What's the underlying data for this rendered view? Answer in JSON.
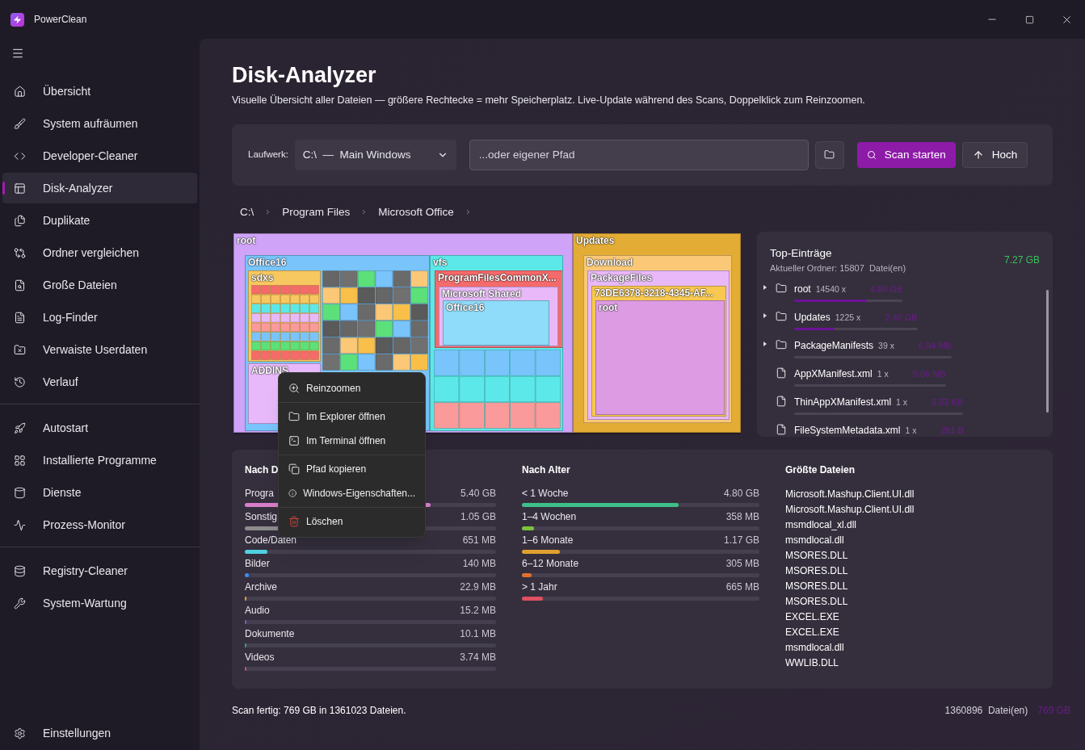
{
  "window": {
    "title": "PowerClean"
  },
  "sidebar": {
    "groups": [
      [
        {
          "label": "Übersicht",
          "selected": false
        },
        {
          "label": "System aufräumen",
          "selected": false
        },
        {
          "label": "Developer-Cleaner",
          "selected": false
        },
        {
          "label": "Disk-Analyzer",
          "selected": true
        },
        {
          "label": "Duplikate",
          "selected": false
        },
        {
          "label": "Ordner vergleichen",
          "selected": false
        },
        {
          "label": "Große Dateien",
          "selected": false
        },
        {
          "label": "Log-Finder",
          "selected": false
        },
        {
          "label": "Verwaiste Userdaten",
          "selected": false
        },
        {
          "label": "Verlauf",
          "selected": false
        }
      ],
      [
        {
          "label": "Autostart",
          "selected": false
        },
        {
          "label": "Installierte Programme",
          "selected": false
        },
        {
          "label": "Dienste",
          "selected": false
        },
        {
          "label": "Prozess-Monitor",
          "selected": false
        }
      ],
      [
        {
          "label": "Registry-Cleaner",
          "selected": false
        },
        {
          "label": "System-Wartung",
          "selected": false
        }
      ]
    ],
    "footer_item": {
      "label": "Einstellungen",
      "selected": false
    }
  },
  "page": {
    "title": "Disk-Analyzer",
    "subtitle": "Visuelle Übersicht aller Dateien — größere Rechtecke = mehr Speicherplatz. Live-Update während des Scans, Doppelklick zum Reinzoomen."
  },
  "toolbar": {
    "drive_label": "Laufwerk:",
    "drive_value": "C:\\  —  Main Windows",
    "path_placeholder": "...oder eigener Pfad",
    "scan_button": "Scan starten",
    "up_button": "Hoch"
  },
  "breadcrumb": [
    "C:\\",
    "Program Files",
    "Microsoft Office"
  ],
  "treemap": {
    "nodes": [
      {
        "label": "root",
        "children": [
          {
            "label": "Office16",
            "children": [
              {
                "label": "sdxs"
              },
              {
                "label": "ADDINS"
              }
            ]
          },
          {
            "label": "vfs",
            "children": [
              {
                "label": "ProgramFilesCommonX...",
                "children": [
                  {
                    "label": "Microsoft Shared",
                    "children": [
                      {
                        "label": "Office16"
                      }
                    ]
                  }
                ]
              }
            ]
          }
        ]
      },
      {
        "label": "Updates",
        "children": [
          {
            "label": "Download",
            "children": [
              {
                "label": "PackageFiles",
                "children": [
                  {
                    "label": "73DE6378-3218-4345-AF...",
                    "children": [
                      {
                        "label": "root"
                      }
                    ]
                  }
                ]
              }
            ]
          }
        ]
      }
    ]
  },
  "context_menu": {
    "groups": [
      [
        {
          "label": "Reinzoomen",
          "kind": "zoom"
        }
      ],
      [
        {
          "label": "Im Explorer öffnen",
          "kind": "folder"
        },
        {
          "label": "Im Terminal öffnen",
          "kind": "terminal"
        }
      ],
      [
        {
          "label": "Pfad kopieren",
          "kind": "copy"
        },
        {
          "label": "Windows-Eigenschaften...",
          "kind": "info"
        }
      ],
      [
        {
          "label": "Löschen",
          "kind": "delete"
        }
      ]
    ]
  },
  "top_entries": {
    "title": "Top-Einträge",
    "subtitle": "Aktueller Ordner: 15807  Datei(en)",
    "total": "7.27 GB",
    "items": [
      {
        "kind": "folder",
        "expanded": false,
        "name": "root",
        "count": "14540 x",
        "size": "4.86 GB",
        "level": 0.67
      },
      {
        "kind": "folder",
        "expanded": false,
        "name": "Updates",
        "count": "1225 x",
        "size": "2.40 GB",
        "level": 0.33
      },
      {
        "kind": "folder",
        "expanded": false,
        "name": "PackageManifests",
        "count": "39 x",
        "size": "6.94 MB"
      },
      {
        "kind": "file",
        "name": "AppXManifest.xml",
        "count": "1 x",
        "size": "5.06 MB"
      },
      {
        "kind": "file",
        "name": "ThinAppXManifest.xml",
        "count": "1 x",
        "size": "3.53 KB"
      },
      {
        "kind": "file",
        "name": "FileSystemMetadata.xml",
        "count": "1 x",
        "size": "281 B"
      }
    ]
  },
  "by_type": {
    "title": "Nach D",
    "items": [
      {
        "label": "Progra",
        "value": "5.40 GB",
        "level": 0.74,
        "color": "#d67fc8"
      },
      {
        "label": "Sonstig",
        "value": "1.05 GB",
        "level": 0.15,
        "color": "#8c8c8c"
      },
      {
        "label": "Code/Daten",
        "value": "651 MB",
        "level": 0.09,
        "color": "#4fd1e0"
      },
      {
        "label": "Bilder",
        "value": "140 MB",
        "level": 0.015,
        "color": "#3b8cf0"
      },
      {
        "label": "Archive",
        "value": "22.9 MB",
        "level": 0.003,
        "color": "#e0a030"
      },
      {
        "label": "Audio",
        "value": "15.2 MB",
        "level": 0.003,
        "color": "#7a5cc8"
      },
      {
        "label": "Dokumente",
        "value": "10.1 MB",
        "level": 0.002,
        "color": "#2aa08a"
      },
      {
        "label": "Videos",
        "value": "3.74 MB",
        "level": 0.001,
        "color": "#c05080"
      }
    ]
  },
  "by_age": {
    "title": "Nach Alter",
    "items": [
      {
        "label": "< 1 Woche",
        "value": "4.80 GB",
        "level": 0.66,
        "color": "#3dbf8a"
      },
      {
        "label": "1–4 Wochen",
        "value": "358 MB",
        "level": 0.05,
        "color": "#7cc23c"
      },
      {
        "label": "1–6 Monate",
        "value": "1.17 GB",
        "level": 0.16,
        "color": "#e0a030"
      },
      {
        "label": "6–12 Monate",
        "value": "305 MB",
        "level": 0.04,
        "color": "#e07030"
      },
      {
        "label": "> 1 Jahr",
        "value": "665 MB",
        "level": 0.09,
        "color": "#e05060"
      }
    ]
  },
  "largest_files": {
    "title": "Größte Dateien",
    "items": [
      "Microsoft.Mashup.Client.UI.dll",
      "Microsoft.Mashup.Client.UI.dll",
      "msmdlocal_xl.dll",
      "msmdlocal.dll",
      "MSORES.DLL",
      "MSORES.DLL",
      "MSORES.DLL",
      "MSORES.DLL",
      "EXCEL.EXE",
      "EXCEL.EXE",
      "msmdlocal.dll",
      "WWLIB.DLL"
    ]
  },
  "status_bar": {
    "left": "Scan fertig: 769 GB in 1361023 Dateien.",
    "files": "1360896  Datei(en)",
    "size": "769 GB"
  }
}
